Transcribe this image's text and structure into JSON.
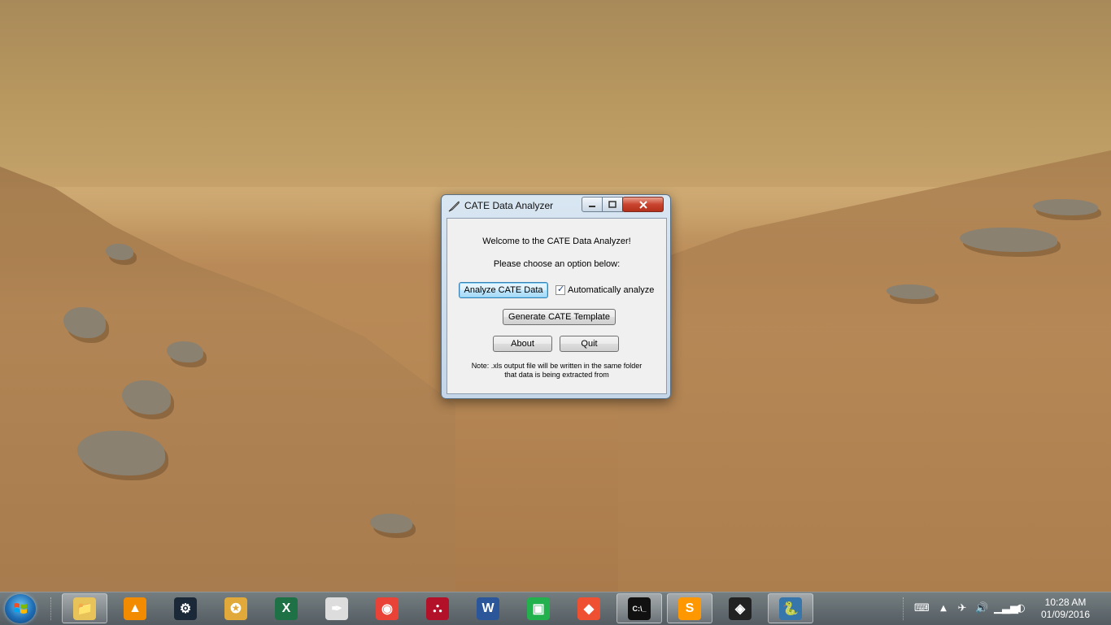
{
  "window": {
    "title": "CATE Data Analyzer",
    "welcome": "Welcome to the CATE Data Analyzer!",
    "prompt": "Please choose an option below:",
    "analyze_button": "Analyze CATE Data",
    "auto_analyze_label": "Automatically analyze",
    "auto_analyze_checked": true,
    "template_button": "Generate CATE Template",
    "about_button": "About",
    "quit_button": "Quit",
    "note_line1": "Note: .xls output file will be written in the same folder",
    "note_line2": "that data is being extracted from"
  },
  "taskbar": {
    "pinned": [
      {
        "name": "file-explorer-icon",
        "glyph": "📁",
        "color": "#e8c35a"
      },
      {
        "name": "vlc-icon",
        "glyph": "▲",
        "color": "#f28b00"
      },
      {
        "name": "steam-icon",
        "glyph": "⚙",
        "color": "#1b2838"
      },
      {
        "name": "hearthstone-icon",
        "glyph": "✪",
        "color": "#e0a93a"
      },
      {
        "name": "excel-icon",
        "glyph": "X",
        "color": "#1e7145"
      },
      {
        "name": "quill-icon",
        "glyph": "✒",
        "color": "#dddddd"
      },
      {
        "name": "chrome-icon",
        "glyph": "◉",
        "color": "#e84336"
      },
      {
        "name": "mendeley-icon",
        "glyph": "⛬",
        "color": "#b3102a"
      },
      {
        "name": "word-icon",
        "glyph": "W",
        "color": "#2b579a"
      },
      {
        "name": "network-app-icon",
        "glyph": "▣",
        "color": "#22b14c"
      },
      {
        "name": "git-icon",
        "glyph": "◆",
        "color": "#f05032"
      },
      {
        "name": "command-prompt-icon",
        "glyph": "C:\\_",
        "color": "#111111"
      },
      {
        "name": "sublime-text-icon",
        "glyph": "S",
        "color": "#ff9800"
      },
      {
        "name": "unity-icon",
        "glyph": "◈",
        "color": "#222222"
      },
      {
        "name": "python-icon",
        "glyph": "🐍",
        "color": "#3776ab"
      }
    ],
    "clock_time": "10:28 AM",
    "clock_date": "01/09/2016"
  }
}
